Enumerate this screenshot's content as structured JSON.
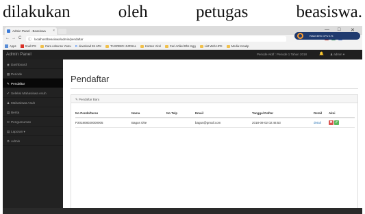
{
  "caption": {
    "words": [
      "dilakukan",
      "oleh",
      "petugas",
      "beasiswa."
    ]
  },
  "browser": {
    "tab_title": "Admin Panel - Beasiswa",
    "tab_close": "×",
    "url": "localhost/beasiswa/admin/pendaftar",
    "back": "←",
    "forward": "→",
    "reload": "C",
    "info": "ⓘ",
    "win_min": "—",
    "win_max": "□",
    "win_close": "✕",
    "star": "☆",
    "stats": "RAM 35%  CPU 1%",
    "bookmarks": [
      {
        "label": "Apps",
        "icon": "apps"
      },
      {
        "label": "Soal IPS",
        "icon": "red"
      },
      {
        "label": "Cara Adsense Youtu",
        "icon": "fold"
      },
      {
        "label": "download 55 APK",
        "icon": "g"
      },
      {
        "label": "TA BOBIGI JURNAL",
        "icon": "fold"
      },
      {
        "label": "Konten Viral",
        "icon": "fold"
      },
      {
        "label": "Cari Artikel Bhs Ingg",
        "icon": "fold"
      },
      {
        "label": "List Web HPK",
        "icon": "fold"
      },
      {
        "label": "Media Kreatip",
        "icon": "fold"
      }
    ]
  },
  "navbar": {
    "brand": "Admin Panel",
    "period": "Periode Aktif : Periode 1 Tahun 2018",
    "bell": "🔔",
    "user": "admin"
  },
  "sidebar": {
    "items": [
      {
        "icon": "◉",
        "label": "Dashboard"
      },
      {
        "icon": "▦",
        "label": "Periode"
      },
      {
        "icon": "✎",
        "label": "Pendaftar"
      },
      {
        "icon": "✔",
        "label": "Seleksi Mahasiswa Asuh"
      },
      {
        "icon": "♟",
        "label": "Mahasiswa Asuh"
      },
      {
        "icon": "▤",
        "label": "Berita"
      },
      {
        "icon": "✉",
        "label": "Pengumuman"
      },
      {
        "icon": "▤",
        "label": "Laporan ▾"
      },
      {
        "icon": "⚙",
        "label": "Admin"
      }
    ],
    "active_index": 2
  },
  "main": {
    "title": "Pendaftar",
    "panel_heading": "✎ Pendaftar Baru",
    "columns": [
      "No Pendaftaran",
      "Nama",
      "No Telp",
      "Email",
      "Tanggal Daftar",
      "Detail",
      "Aksi"
    ],
    "rows": [
      {
        "no": "P201808020000005",
        "nama": "Bagus Oke",
        "telp": "",
        "email": "bagus@gmail.com",
        "tanggal": "2018-08-02 02:46:53",
        "detail": "detail"
      }
    ],
    "delete_glyph": "✖",
    "approve_glyph": "✔"
  },
  "colors": {
    "navbar": "#1f1f1f",
    "sidebar": "#222222",
    "link": "#337ab7",
    "danger": "#d9534f",
    "success": "#5cb85c"
  }
}
